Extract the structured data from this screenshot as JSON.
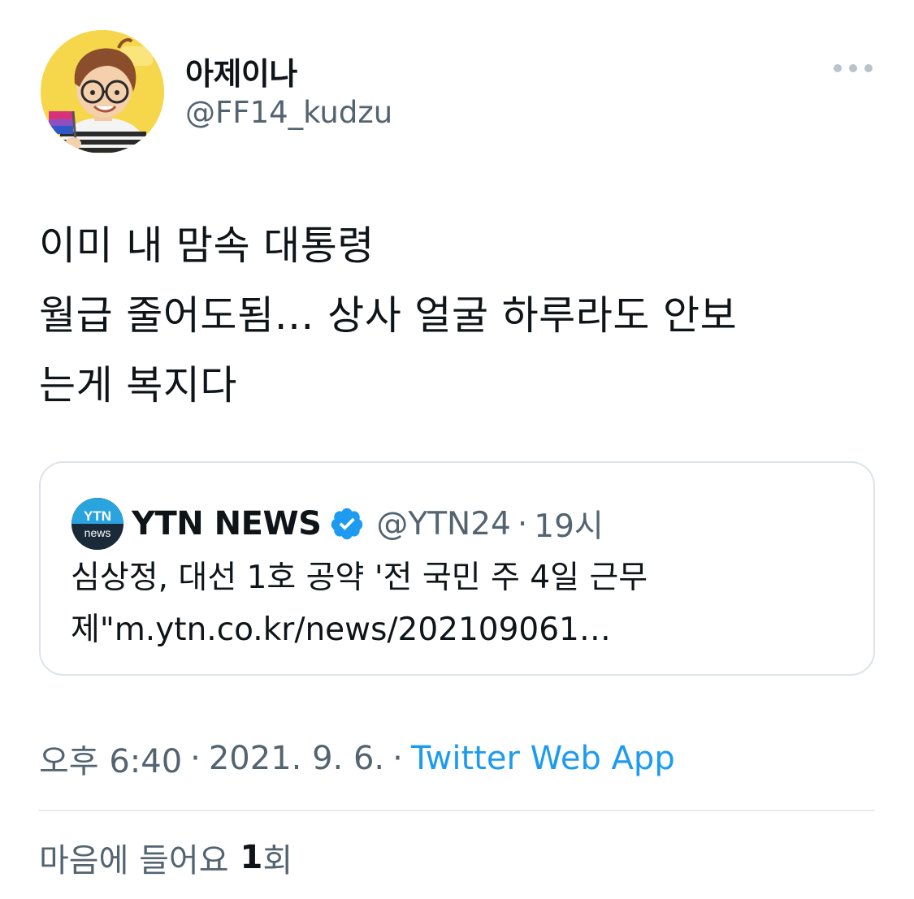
{
  "author": {
    "display_name": "아제이나",
    "handle": "@FF14_kudzu",
    "avatar_icon": "cartoon-avatar"
  },
  "more_icon": "more-horizontal-icon",
  "tweet": {
    "lines": [
      "이미 내 맘속 대통령",
      "월급 줄어도됨… 상사 얼굴 하루라도 안보",
      "는게 복지다"
    ]
  },
  "quote": {
    "avatar_text_top": "YTN",
    "avatar_text_bottom": "news",
    "name": "YTN NEWS",
    "verified_icon": "verified-badge-icon",
    "handle": "@YTN24",
    "separator": "·",
    "time": "19시",
    "text_lines": [
      "심상정, 대선 1호 공약 '전 국민 주 4일 근무",
      "제\"m.ytn.co.kr/news/202109061…"
    ]
  },
  "meta": {
    "time": "오후 6:40",
    "sep1": "·",
    "date": "2021. 9. 6.",
    "sep2": "·",
    "source": "Twitter Web App"
  },
  "likes": {
    "label": "마음에 들어요",
    "count": "1",
    "unit": "회"
  },
  "colors": {
    "text": "#0f1419",
    "secondary": "#536471",
    "link": "#1d9bf0",
    "border": "#dde3e8",
    "verified": "#1d9bf0"
  }
}
